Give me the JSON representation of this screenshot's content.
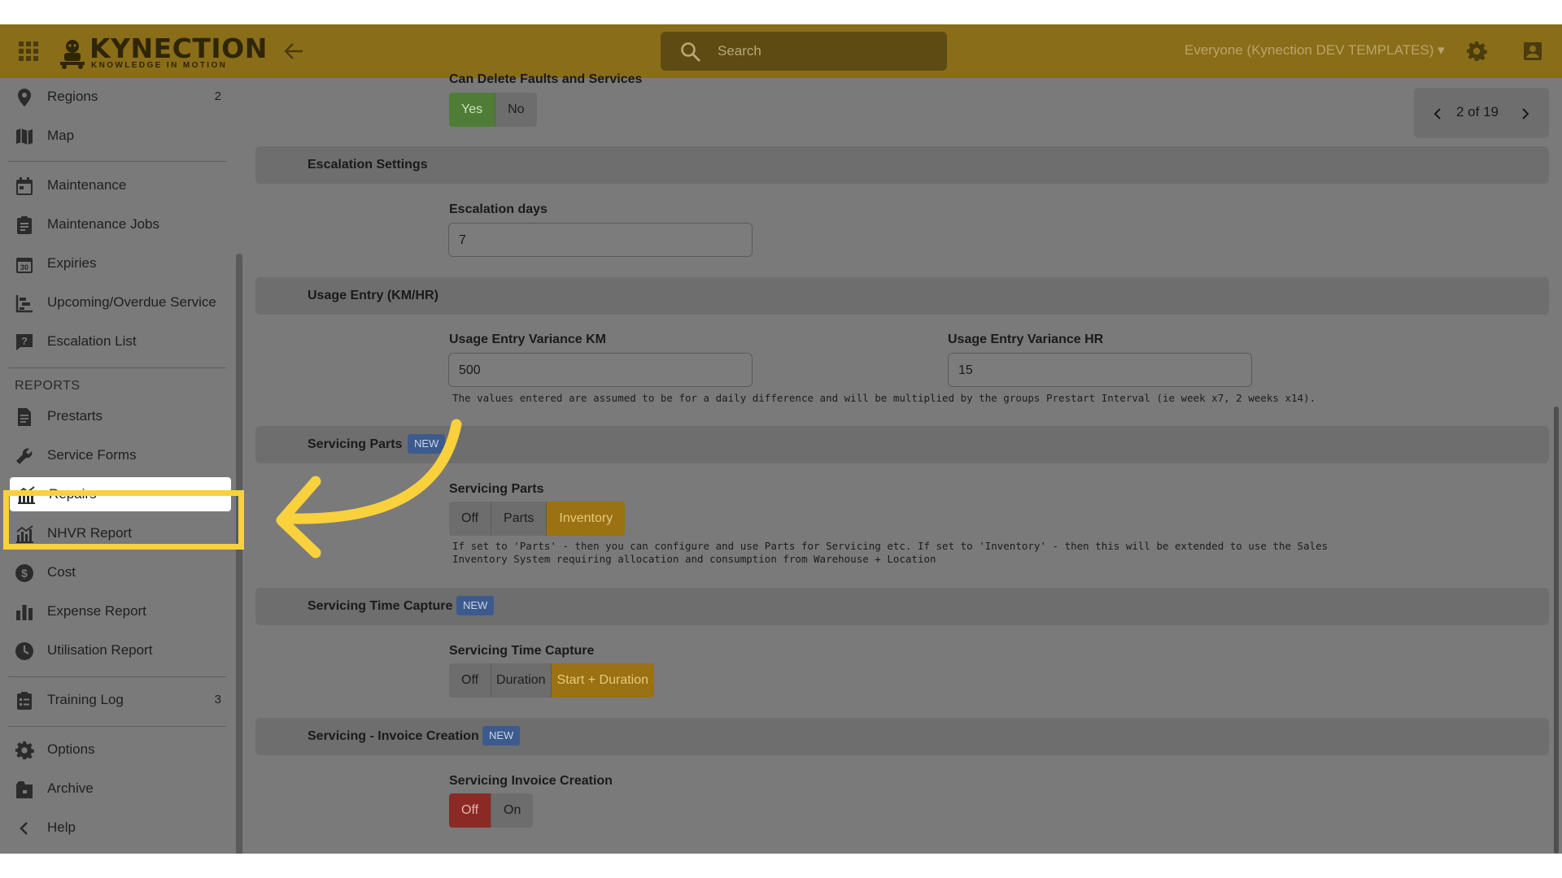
{
  "topbar": {
    "logo_text": "KYNECTION",
    "logo_tagline": "KNOWLEDGE IN MOTION",
    "search_placeholder": "Search",
    "user_context": "Everyone (Kynection DEV TEMPLATES) ▾"
  },
  "sidebar": {
    "items": [
      {
        "label": "Regions",
        "badge": "2",
        "icon": "location-pin-icon"
      },
      {
        "label": "Map",
        "icon": "map-icon"
      },
      {
        "label": "Maintenance",
        "icon": "calendar-icon"
      },
      {
        "label": "Maintenance Jobs",
        "icon": "clipboard-icon"
      },
      {
        "label": "Expiries",
        "icon": "calendar-30-icon"
      },
      {
        "label": "Upcoming/Overdue Service",
        "icon": "timeline-icon"
      },
      {
        "label": "Escalation List",
        "icon": "question-comment-icon"
      }
    ],
    "reports_heading": "REPORTS",
    "reports": [
      {
        "label": "Prestarts",
        "icon": "document-icon"
      },
      {
        "label": "Service Forms",
        "icon": "wrench-icon"
      },
      {
        "label": "Repairs",
        "icon": "chart-line-icon",
        "active": true
      },
      {
        "label": "NHVR Report",
        "icon": "chart-line-icon"
      },
      {
        "label": "Cost",
        "icon": "dollar-icon"
      },
      {
        "label": "Expense Report",
        "icon": "bar-chart-icon"
      },
      {
        "label": "Utilisation Report",
        "icon": "clock-icon"
      }
    ],
    "training": {
      "label": "Training Log",
      "badge": "3",
      "icon": "checklist-icon"
    },
    "bottom": [
      {
        "label": "Options",
        "icon": "gear-icon"
      },
      {
        "label": "Archive",
        "icon": "archive-icon"
      },
      {
        "label": "Help",
        "icon": "chevron-left-icon"
      }
    ]
  },
  "pager": {
    "text": "2 of 19"
  },
  "main": {
    "can_delete": {
      "label": "Can Delete Faults and Services",
      "options": [
        "Yes",
        "No"
      ],
      "selected": "Yes"
    },
    "escalation": {
      "title": "Escalation Settings",
      "days_label": "Escalation days",
      "days_value": "7"
    },
    "usage": {
      "title": "Usage Entry (KM/HR)",
      "km_label": "Usage Entry Variance KM",
      "km_value": "500",
      "hr_label": "Usage Entry Variance HR",
      "hr_value": "15",
      "help": "The values entered are assumed to be for a daily difference and will be multiplied by the groups Prestart Interval (ie week x7, 2 weeks x14)."
    },
    "servicing_parts": {
      "title": "Servicing Parts",
      "badge": "NEW",
      "label": "Servicing Parts",
      "options": [
        "Off",
        "Parts",
        "Inventory"
      ],
      "selected": "Inventory",
      "help_line1": "If set to 'Parts' - then you can configure and use Parts for Servicing etc. If set to 'Inventory' - then this will be extended to use the Sales",
      "help_line2": "Inventory System requiring allocation and consumption from Warehouse + Location"
    },
    "time_capture": {
      "title": "Servicing Time Capture",
      "badge": "NEW",
      "label": "Servicing Time Capture",
      "options": [
        "Off",
        "Duration",
        "Start + Duration"
      ],
      "selected": "Start + Duration"
    },
    "invoice": {
      "title": "Servicing - Invoice Creation",
      "badge": "NEW",
      "label": "Servicing Invoice Creation",
      "options": [
        "Off",
        "On"
      ],
      "selected": "Off"
    }
  },
  "colors": {
    "topbar": "#8a6d18",
    "overlay_bg": "#7a7a7a",
    "highlight": "#f9d13d",
    "green": "#4f7d37",
    "orange": "#9a7113",
    "red": "#8b2a25",
    "badge_blue": "#3d5a8c"
  }
}
